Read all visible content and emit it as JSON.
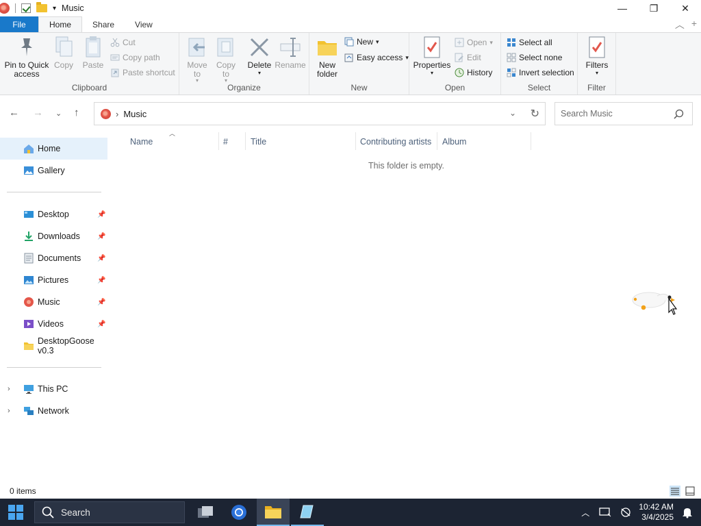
{
  "window": {
    "title": "Music",
    "controls": {
      "minimize": "—",
      "maximize": "❐",
      "close": "✕"
    }
  },
  "tabs": [
    {
      "label": "File"
    },
    {
      "label": "Home"
    },
    {
      "label": "Share"
    },
    {
      "label": "View"
    }
  ],
  "ribbon": {
    "clipboard": {
      "label": "Clipboard",
      "pin": "Pin to Quick access",
      "pin_l1": "Pin to Quick",
      "pin_l2": "access",
      "copy": "Copy",
      "paste": "Paste",
      "cut": "Cut",
      "copy_path": "Copy path",
      "paste_shortcut": "Paste shortcut"
    },
    "organize": {
      "label": "Organize",
      "move_l1": "Move",
      "move_l2": "to",
      "copy_l1": "Copy",
      "copy_l2": "to",
      "delete": "Delete",
      "rename": "Rename"
    },
    "new": {
      "label": "New",
      "new_folder_l1": "New",
      "new_folder_l2": "folder",
      "new_item": "New",
      "easy_access": "Easy access"
    },
    "open": {
      "label": "Open",
      "properties": "Properties",
      "open": "Open",
      "edit": "Edit",
      "history": "History"
    },
    "select": {
      "label": "Select",
      "select_all": "Select all",
      "select_none": "Select none",
      "invert": "Invert selection"
    },
    "filter": {
      "label": "Filter",
      "filters": "Filters"
    }
  },
  "address": {
    "path": "Music",
    "search_placeholder": "Search Music"
  },
  "sidebar": {
    "top": [
      {
        "label": "Home"
      },
      {
        "label": "Gallery"
      }
    ],
    "quick": [
      {
        "label": "Desktop"
      },
      {
        "label": "Downloads"
      },
      {
        "label": "Documents"
      },
      {
        "label": "Pictures"
      },
      {
        "label": "Music"
      },
      {
        "label": "Videos"
      },
      {
        "label": "DesktopGoose v0.3"
      }
    ],
    "bottom": [
      {
        "label": "This PC"
      },
      {
        "label": "Network"
      }
    ]
  },
  "content": {
    "columns": [
      "Name",
      "#",
      "Title",
      "Contributing artists",
      "Album"
    ],
    "empty_message": "This folder is empty."
  },
  "status": {
    "items": "0 items"
  },
  "taskbar": {
    "search_label": "Search",
    "time": "10:42 AM",
    "date": "3/4/2025"
  },
  "colors": {
    "file_tab": "#1979ca",
    "selection": "#e5f1fb",
    "taskbar": "#1c2433"
  }
}
